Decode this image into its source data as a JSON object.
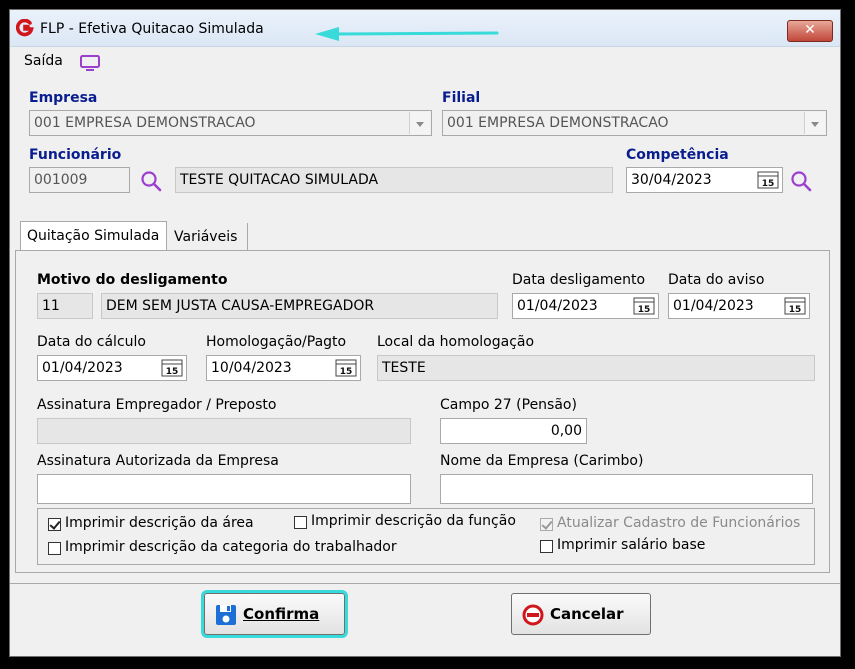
{
  "window": {
    "title": "FLP - Efetiva Quitacao Simulada",
    "close_label": "✕"
  },
  "menu": {
    "saida": "Saída"
  },
  "empresa": {
    "label": "Empresa",
    "value": "001 EMPRESA DEMONSTRACAO"
  },
  "filial": {
    "label": "Filial",
    "value": "001 EMPRESA DEMONSTRACAO"
  },
  "funcionario": {
    "label": "Funcionário",
    "code": "001009",
    "name": "TESTE QUITACAO SIMULADA"
  },
  "competencia": {
    "label": "Competência",
    "value": "30/04/2023"
  },
  "tabs": [
    {
      "label": "Quitação Simulada",
      "active": true
    },
    {
      "label": "Variáveis",
      "active": false
    }
  ],
  "motivo": {
    "label": "Motivo do desligamento",
    "code": "11",
    "description": "DEM SEM JUSTA CAUSA-EMPREGADOR"
  },
  "data_desligamento": {
    "label": "Data desligamento",
    "value": "01/04/2023"
  },
  "data_aviso": {
    "label": "Data do aviso",
    "value": "01/04/2023"
  },
  "data_calculo": {
    "label": "Data do cálculo",
    "value": "01/04/2023"
  },
  "homologacao": {
    "label": "Homologação/Pagto",
    "value": "10/04/2023"
  },
  "local_homologacao": {
    "label": "Local da homologação",
    "value": "TESTE"
  },
  "assinatura_empregador": {
    "label": "Assinatura Empregador / Preposto",
    "value": ""
  },
  "campo27": {
    "label": "Campo 27 (Pensão)",
    "value": "0,00"
  },
  "assinatura_autorizada": {
    "label": "Assinatura Autorizada da Empresa",
    "value": ""
  },
  "nome_empresa": {
    "label": "Nome da Empresa (Carimbo)",
    "value": ""
  },
  "checkboxes": [
    {
      "label": "Imprimir descrição da área",
      "checked": true,
      "enabled": true
    },
    {
      "label": "Imprimir descrição da função",
      "checked": false,
      "enabled": true
    },
    {
      "label": "Atualizar Cadastro de Funcionários",
      "checked": true,
      "enabled": false
    },
    {
      "label": "Imprimir descrição da categoria do trabalhador",
      "checked": false,
      "enabled": true
    },
    {
      "label": "Imprimir salário base",
      "checked": false,
      "enabled": true
    }
  ],
  "buttons": {
    "confirma": "Confirma",
    "cancelar": "Cancelar"
  },
  "colors": {
    "accent_label": "#0a1d8f",
    "highlight": "#38dada",
    "icon_purple": "#9b3fcf",
    "cancel_red": "#d0161b",
    "save_blue": "#1c6fd6"
  },
  "icons": {
    "app": "app-logo-icon",
    "monitor": "monitor-icon",
    "search": "magnifier-icon",
    "calendar": "calendar-icon",
    "save": "floppy-disk-icon",
    "cancel": "no-entry-icon"
  }
}
